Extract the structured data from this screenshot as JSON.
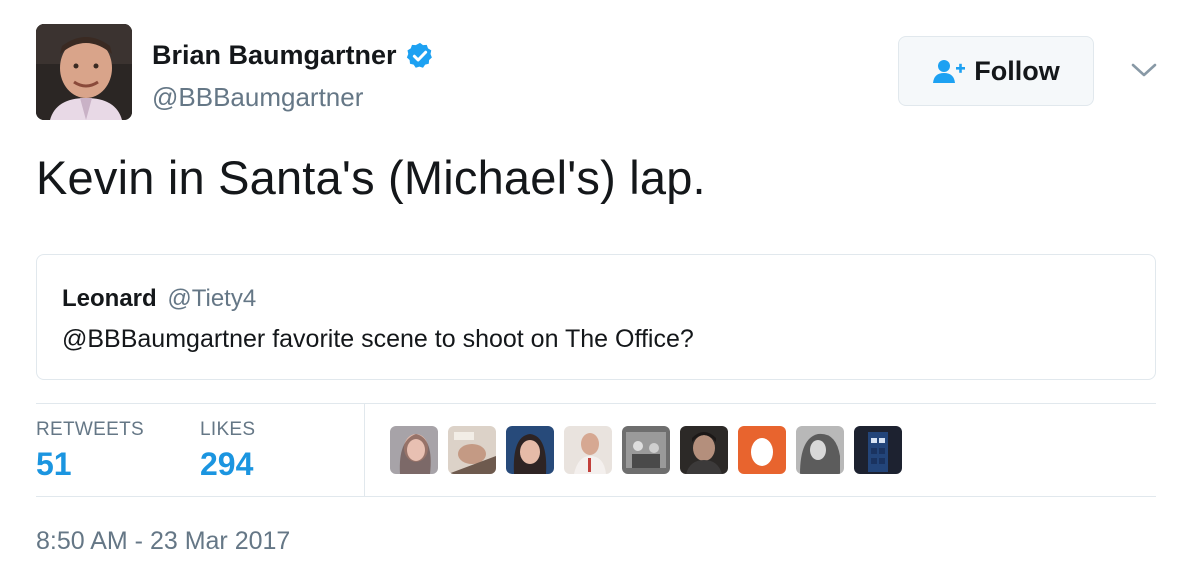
{
  "author": {
    "name": "Brian Baumgartner",
    "handle": "@BBBaumgartner",
    "verified": true,
    "avatar_icon": "profile-photo"
  },
  "follow_button": {
    "label": "Follow",
    "icon": "follow-person-plus-icon"
  },
  "menu_icon": "chevron-down-icon",
  "tweet": {
    "text": "Kevin in Santa's (Michael's) lap."
  },
  "quoted_tweet": {
    "name": "Leonard",
    "handle": "@Tiety4",
    "text": "@BBBaumgartner favorite scene to shoot on The Office?"
  },
  "stats": {
    "retweets_label": "RETWEETS",
    "retweets_value": "51",
    "likes_label": "LIKES",
    "likes_value": "294"
  },
  "likers": [
    {
      "icon": "liker-avatar-1",
      "color": "#9a8c8e"
    },
    {
      "icon": "liker-avatar-2",
      "color": "#b9aca2"
    },
    {
      "icon": "liker-avatar-3",
      "color": "#4d6a8f"
    },
    {
      "icon": "liker-avatar-4",
      "color": "#c9b7ad"
    },
    {
      "icon": "liker-avatar-5",
      "color": "#7b7b7b"
    },
    {
      "icon": "liker-avatar-6",
      "color": "#3a3634"
    },
    {
      "icon": "liker-avatar-egg-7",
      "color": "#e8642e"
    },
    {
      "icon": "liker-avatar-8",
      "color": "#8e8e8e"
    },
    {
      "icon": "liker-avatar-9",
      "color": "#2c3a55"
    }
  ],
  "timestamp": "8:50 AM - 23 Mar 2017",
  "colors": {
    "accent": "#1b95e0",
    "verified": "#1da1f2",
    "secondary_text": "#657786",
    "border": "#e1e8ed"
  }
}
